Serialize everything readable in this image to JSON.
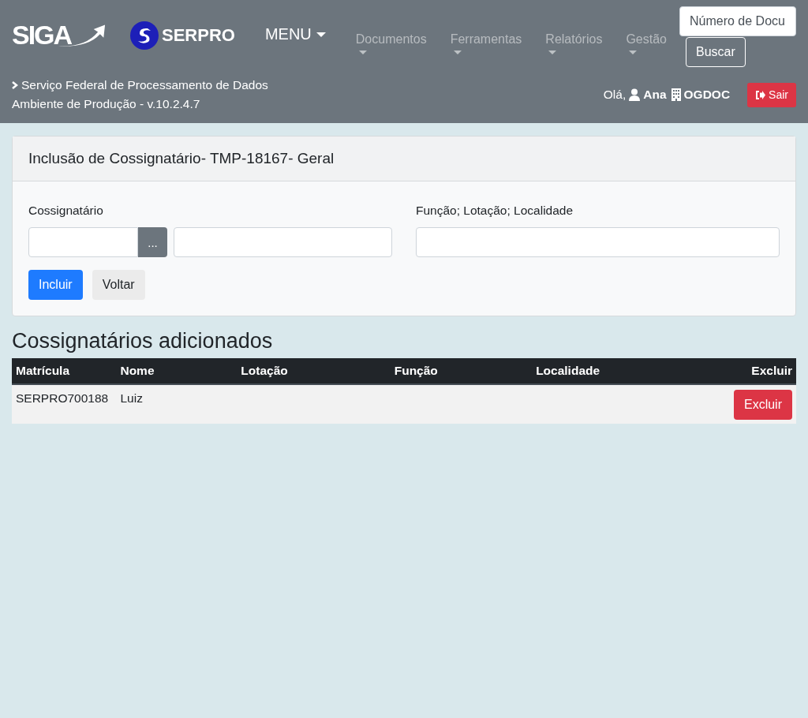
{
  "header": {
    "logo_text": "SIGA",
    "brand_text": "SERPRO",
    "menu": "MENU",
    "nav": [
      {
        "label": "Documentos"
      },
      {
        "label": "Ferramentas"
      },
      {
        "label": "Relatórios"
      },
      {
        "label": "Gestão"
      }
    ],
    "search": {
      "value": "Número de Docu",
      "button": "Buscar"
    },
    "org_line": "Serviço Federal de Processamento de Dados",
    "env_line": "Ambiente de Produção - v.10.2.4.7",
    "greeting": "Olá,",
    "user": "Ana",
    "unit": "OGDOC",
    "logout": "Sair"
  },
  "form": {
    "title": "Inclusão de Cossignatário- TMP-18167- Geral",
    "cosigner_label": "Cossignatário",
    "lookup_button": "...",
    "role_label": "Função; Lotação; Localidade",
    "submit": "Incluir",
    "back": "Voltar"
  },
  "table": {
    "heading": "Cossignatários adicionados",
    "columns": [
      "Matrícula",
      "Nome",
      "Lotação",
      "Função",
      "Localidade",
      "Excluir"
    ],
    "rows": [
      {
        "cells": [
          "SERPRO700188",
          "Luiz",
          "",
          "",
          ""
        ],
        "action": "Excluir"
      }
    ]
  }
}
